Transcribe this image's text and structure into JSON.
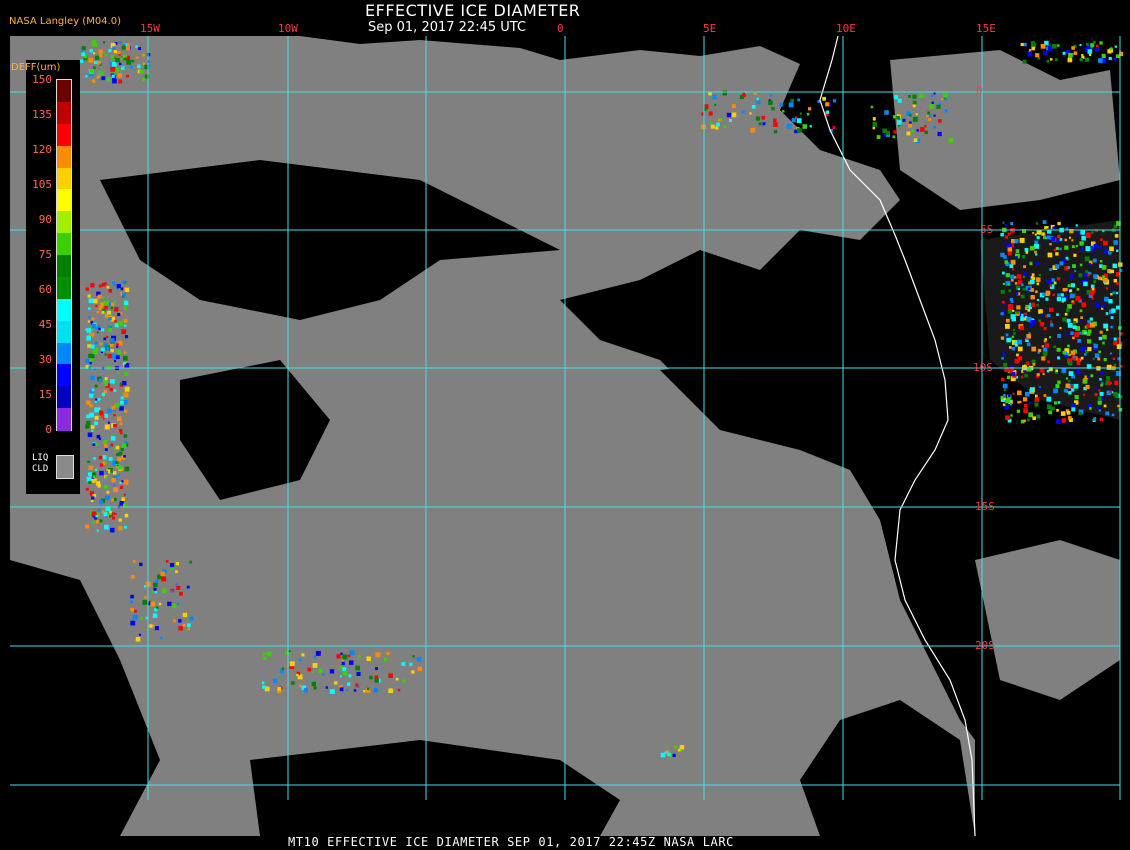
{
  "header": {
    "title": "EFFECTIVE ICE DIAMETER",
    "subtitle": "Sep 01, 2017 22:45 UTC",
    "credit": "NASA Langley (M04.0)"
  },
  "footer": "MT10  EFFECTIVE ICE DIAMETER   SEP 01, 2017 22:45Z   NASA LARC",
  "grid": {
    "longitude_labels": [
      "15W",
      "10W",
      "0",
      "5E",
      "10E",
      "15E"
    ],
    "latitude_labels": [
      "0",
      "5S",
      "10S",
      "15S",
      "20S"
    ]
  },
  "legend": {
    "unit": "DEFF(um)",
    "ticks": [
      "150",
      "135",
      "120",
      "105",
      "90",
      "75",
      "60",
      "45",
      "30",
      "15",
      "0"
    ],
    "colors": [
      "#6b0000",
      "#c00000",
      "#ff0000",
      "#ff8c00",
      "#ffd000",
      "#ffff00",
      "#a0f000",
      "#3cd000",
      "#008000",
      "#009000",
      "#00ffff",
      "#00e0f0",
      "#0088ff",
      "#0000ff",
      "#0000c0",
      "#8a2be2"
    ],
    "liquid_label_line1": "LIQ",
    "liquid_label_line2": "CLD",
    "liquid_color": "#8a8a8a"
  },
  "map": {
    "background": "#000000",
    "cloud_color": "#808080",
    "grid_color": "#40e0e8",
    "coast_color": "#ffffff"
  }
}
